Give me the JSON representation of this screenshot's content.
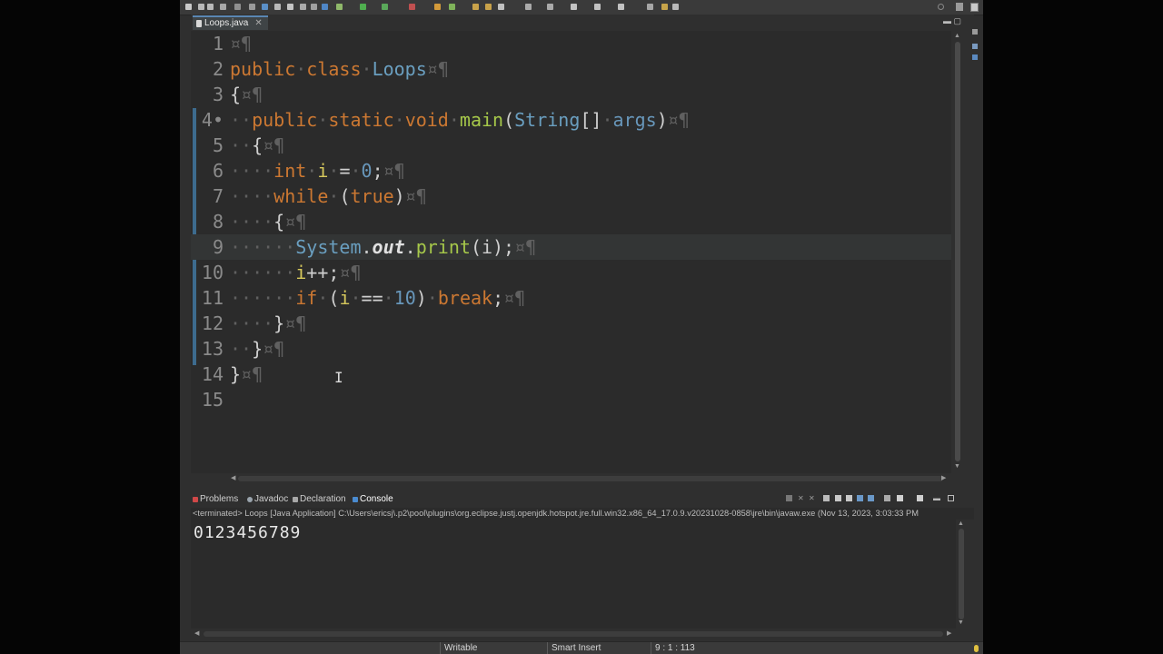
{
  "editor_tab": {
    "title": "Loops.java",
    "close": "✕"
  },
  "code_lines": [
    {
      "num": "1",
      "tokens": [
        [
          "ws",
          "¤¶"
        ]
      ]
    },
    {
      "num": "2",
      "tokens": [
        [
          "kw",
          "public"
        ],
        [
          "ws",
          "·"
        ],
        [
          "kw",
          "class"
        ],
        [
          "ws",
          "·"
        ],
        [
          "ty",
          "Loops"
        ],
        [
          "ws",
          "¤¶"
        ]
      ]
    },
    {
      "num": "3",
      "tokens": [
        [
          "pl",
          "{"
        ],
        [
          "ws",
          "¤¶"
        ]
      ]
    },
    {
      "num": "4•",
      "tokens": [
        [
          "ws",
          "··"
        ],
        [
          "kw",
          "public"
        ],
        [
          "ws",
          "·"
        ],
        [
          "kw",
          "static"
        ],
        [
          "ws",
          "·"
        ],
        [
          "kw",
          "void"
        ],
        [
          "ws",
          "·"
        ],
        [
          "fn",
          "main"
        ],
        [
          "pl",
          "("
        ],
        [
          "ty",
          "String"
        ],
        [
          "pl",
          "[]"
        ],
        [
          "ws",
          "·"
        ],
        [
          "num",
          "args"
        ],
        [
          "pl",
          ")"
        ],
        [
          "ws",
          "¤¶"
        ]
      ]
    },
    {
      "num": "5",
      "tokens": [
        [
          "ws",
          "··"
        ],
        [
          "pl",
          "{"
        ],
        [
          "ws",
          "¤¶"
        ]
      ]
    },
    {
      "num": "6",
      "tokens": [
        [
          "ws",
          "····"
        ],
        [
          "kw",
          "int"
        ],
        [
          "ws",
          "·"
        ],
        [
          "var",
          "i"
        ],
        [
          "ws",
          "·"
        ],
        [
          "pl",
          "="
        ],
        [
          "ws",
          "·"
        ],
        [
          "num",
          "0"
        ],
        [
          "pl",
          ";"
        ],
        [
          "ws",
          "¤¶"
        ]
      ]
    },
    {
      "num": "7",
      "tokens": [
        [
          "ws",
          "····"
        ],
        [
          "kw",
          "while"
        ],
        [
          "ws",
          "·"
        ],
        [
          "pl",
          "("
        ],
        [
          "kw",
          "true"
        ],
        [
          "pl",
          ")"
        ],
        [
          "ws",
          "¤¶"
        ]
      ]
    },
    {
      "num": "8",
      "tokens": [
        [
          "ws",
          "····"
        ],
        [
          "pl",
          "{"
        ],
        [
          "ws",
          "¤¶"
        ]
      ]
    },
    {
      "num": "9",
      "tokens": [
        [
          "ws",
          "······"
        ],
        [
          "ty",
          "System"
        ],
        [
          "pl",
          "."
        ],
        [
          "it",
          "out"
        ],
        [
          "pl",
          "."
        ],
        [
          "fn",
          "print"
        ],
        [
          "pl",
          "(i);"
        ],
        [
          "ws",
          "¤¶"
        ]
      ]
    },
    {
      "num": "10",
      "tokens": [
        [
          "ws",
          "······"
        ],
        [
          "var",
          "i"
        ],
        [
          "pl",
          "++;"
        ],
        [
          "ws",
          "¤¶"
        ]
      ]
    },
    {
      "num": "11",
      "tokens": [
        [
          "ws",
          "······"
        ],
        [
          "kw",
          "if"
        ],
        [
          "ws",
          "·"
        ],
        [
          "pl",
          "("
        ],
        [
          "var",
          "i"
        ],
        [
          "ws",
          "·"
        ],
        [
          "pl",
          "=="
        ],
        [
          "ws",
          "·"
        ],
        [
          "num",
          "10"
        ],
        [
          "pl",
          ")"
        ],
        [
          "ws",
          "·"
        ],
        [
          "kw",
          "break"
        ],
        [
          "pl",
          ";"
        ],
        [
          "ws",
          "¤¶"
        ]
      ]
    },
    {
      "num": "12",
      "tokens": [
        [
          "ws",
          "····"
        ],
        [
          "pl",
          "}"
        ],
        [
          "ws",
          "¤¶"
        ]
      ]
    },
    {
      "num": "13",
      "tokens": [
        [
          "ws",
          "··"
        ],
        [
          "pl",
          "}"
        ],
        [
          "ws",
          "¤¶"
        ]
      ]
    },
    {
      "num": "14",
      "tokens": [
        [
          "pl",
          "}"
        ],
        [
          "ws",
          "¤¶"
        ]
      ]
    },
    {
      "num": "15",
      "tokens": []
    }
  ],
  "current_line": 9,
  "panel_tabs": [
    {
      "label": "Problems",
      "icon": "problems-icon",
      "color": "#d04848",
      "active": false
    },
    {
      "label": "Javadoc",
      "icon": "javadoc-icon",
      "color": "#9aa4ad",
      "active": false
    },
    {
      "label": "Declaration",
      "icon": "declaration-icon",
      "color": "#a8a8a8",
      "active": false
    },
    {
      "label": "Console",
      "icon": "console-icon",
      "color": "#4a8bd0",
      "active": true
    }
  ],
  "console": {
    "path": "<terminated> Loops [Java Application] C:\\Users\\ericsj\\.p2\\pool\\plugins\\org.eclipse.justj.openjdk.hotspot.jre.full.win32.x86_64_17.0.9.v20231028-0858\\jre\\bin\\javaw.exe  (Nov 13, 2023, 3:03:33 PM",
    "output": "0123456789"
  },
  "status": {
    "writable": "Writable",
    "insert_mode": "Smart Insert",
    "position": "9 : 1 : 113"
  }
}
